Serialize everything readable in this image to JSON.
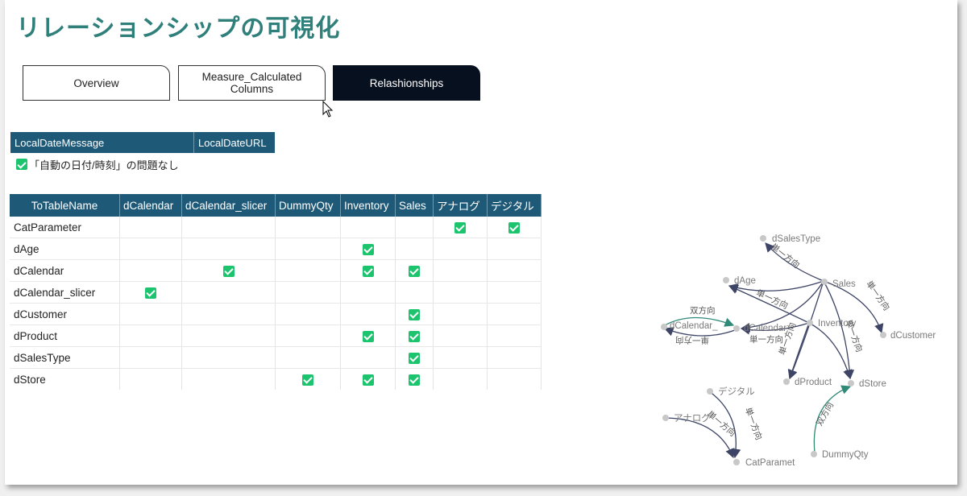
{
  "page": {
    "title": "リレーションシップの可視化"
  },
  "tabs": [
    {
      "label": "Overview",
      "active": false
    },
    {
      "label": "Measure_Calculated Columns",
      "active": false
    },
    {
      "label": "Relashionships",
      "active": true
    }
  ],
  "local_date": {
    "headers": [
      "LocalDateMessage",
      "LocalDateURL"
    ],
    "message": "「自動の日付/時刻」の問題なし",
    "checked": true
  },
  "matrix": {
    "columns": [
      "ToTableName",
      "dCalendar",
      "dCalendar_slicer",
      "DummyQty",
      "Inventory",
      "Sales",
      "アナログ",
      "デジタル"
    ],
    "rows": [
      {
        "name": "CatParameter",
        "checks": [
          false,
          false,
          false,
          false,
          false,
          true,
          true
        ]
      },
      {
        "name": "dAge",
        "checks": [
          false,
          false,
          false,
          true,
          false,
          false,
          false
        ]
      },
      {
        "name": "dCalendar",
        "checks": [
          false,
          true,
          false,
          true,
          true,
          false,
          false
        ]
      },
      {
        "name": "dCalendar_slicer",
        "checks": [
          true,
          false,
          false,
          false,
          false,
          false,
          false
        ]
      },
      {
        "name": "dCustomer",
        "checks": [
          false,
          false,
          false,
          false,
          true,
          false,
          false
        ]
      },
      {
        "name": "dProduct",
        "checks": [
          false,
          false,
          false,
          true,
          true,
          false,
          false
        ]
      },
      {
        "name": "dSalesType",
        "checks": [
          false,
          false,
          false,
          false,
          true,
          false,
          false
        ]
      },
      {
        "name": "dStore",
        "checks": [
          false,
          false,
          true,
          true,
          true,
          false,
          false
        ]
      }
    ]
  },
  "graph": {
    "nodes": {
      "dSalesType": "dSalesType",
      "dAge": "dAge",
      "Sales": "Sales",
      "dCalendar_": "dCalendar_",
      "dCalendar": "dCalendar",
      "Inventory": "Inventory",
      "dCustomer": "dCustomer",
      "dProduct": "dProduct",
      "dStore": "dStore",
      "デジタル": "デジタル",
      "アナログ": "アナログ",
      "CatParamet": "CatParamet",
      "DummyQty": "DummyQty"
    },
    "edge_labels": {
      "single": "単一方向",
      "both": "双方向"
    },
    "colors": {
      "single": "#3d4466",
      "both": "#2f8a78",
      "node": "#c8c8c8"
    }
  }
}
